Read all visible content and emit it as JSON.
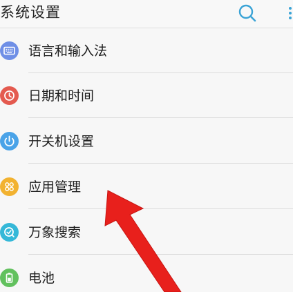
{
  "header": {
    "title": "系统设置",
    "search_icon": "search-icon",
    "more_icon": "more-vertical-icon"
  },
  "settings": [
    {
      "label": "语言和输入法",
      "icon": "keyboard-icon",
      "color": "#6f8fe6"
    },
    {
      "label": "日期和时间",
      "icon": "clock-icon",
      "color": "#e45a4f"
    },
    {
      "label": "开关机设置",
      "icon": "power-icon",
      "color": "#4aa3e8"
    },
    {
      "label": "应用管理",
      "icon": "apps-grid-icon",
      "color": "#f2b230"
    },
    {
      "label": "万象搜索",
      "icon": "search-circle-icon",
      "color": "#35b8d8"
    },
    {
      "label": "电池",
      "icon": "battery-icon",
      "color": "#62c15e"
    }
  ],
  "annotation": {
    "arrow_color": "#e8201c",
    "arrow_icon": "red-arrow-icon",
    "points_to": "应用管理"
  }
}
